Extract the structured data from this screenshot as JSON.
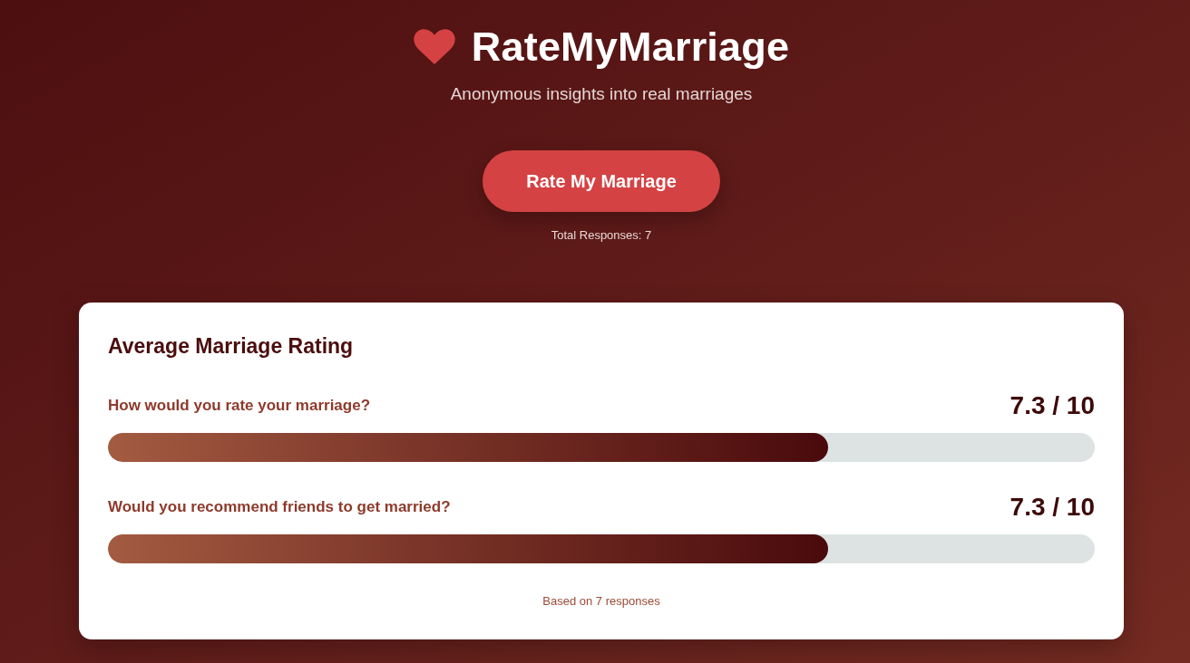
{
  "header": {
    "title": "RateMyMarriage",
    "subtitle": "Anonymous insights into real marriages"
  },
  "cta": {
    "label": "Rate My Marriage",
    "total_responses": "Total Responses: 7"
  },
  "card": {
    "title": "Average Marriage Rating",
    "questions": [
      {
        "label": "How would you rate your marriage?",
        "score": "7.3 / 10",
        "level": 0.73
      },
      {
        "label": "Would you recommend friends to get married?",
        "score": "7.3 / 10",
        "level": 0.73
      }
    ],
    "footer": "Based on 7 responses"
  }
}
